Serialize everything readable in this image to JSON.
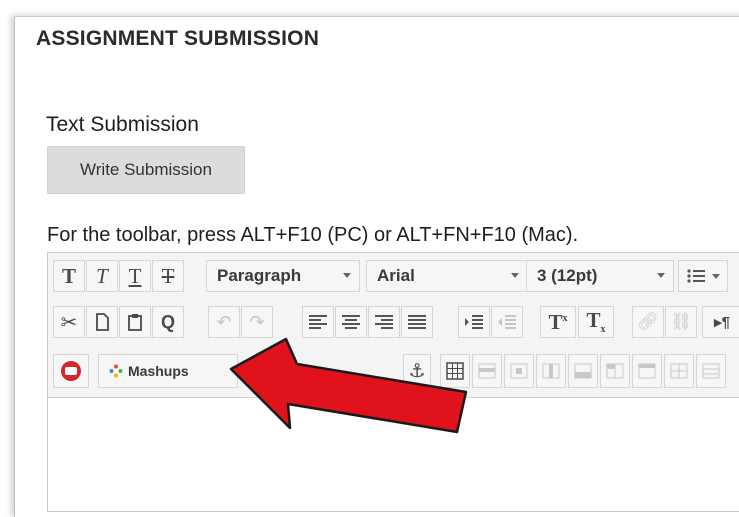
{
  "section": {
    "title": "ASSIGNMENT SUBMISSION",
    "text_submission_label": "Text Submission",
    "write_button_label": "Write Submission",
    "toolbar_hint": "For the toolbar, press ALT+F10 (PC) or ALT+FN+F10 (Mac)."
  },
  "toolbar": {
    "format_select": "Paragraph",
    "font_select": "Arial",
    "size_select": "3 (12pt)",
    "mashups_label": "Mashups"
  },
  "colors": {
    "arrow": "#e0121b",
    "youtube": "#d7262b",
    "button_bg": "#dcdcdc"
  },
  "icons": {
    "row1": [
      "bold-icon",
      "italic-icon",
      "underline-icon",
      "strikethrough-icon"
    ],
    "row2": [
      "cut-icon",
      "copy-icon",
      "paste-icon",
      "find-icon",
      "undo-icon",
      "redo-icon",
      "align-left-icon",
      "align-center-icon",
      "align-right-icon",
      "align-justify-icon",
      "indent-icon",
      "outdent-icon",
      "superscript-icon",
      "subscript-icon",
      "link-icon",
      "unlink-icon"
    ],
    "row3": [
      "youtube-icon",
      "mashups-icon",
      "anchor-icon",
      "table-icon"
    ]
  }
}
